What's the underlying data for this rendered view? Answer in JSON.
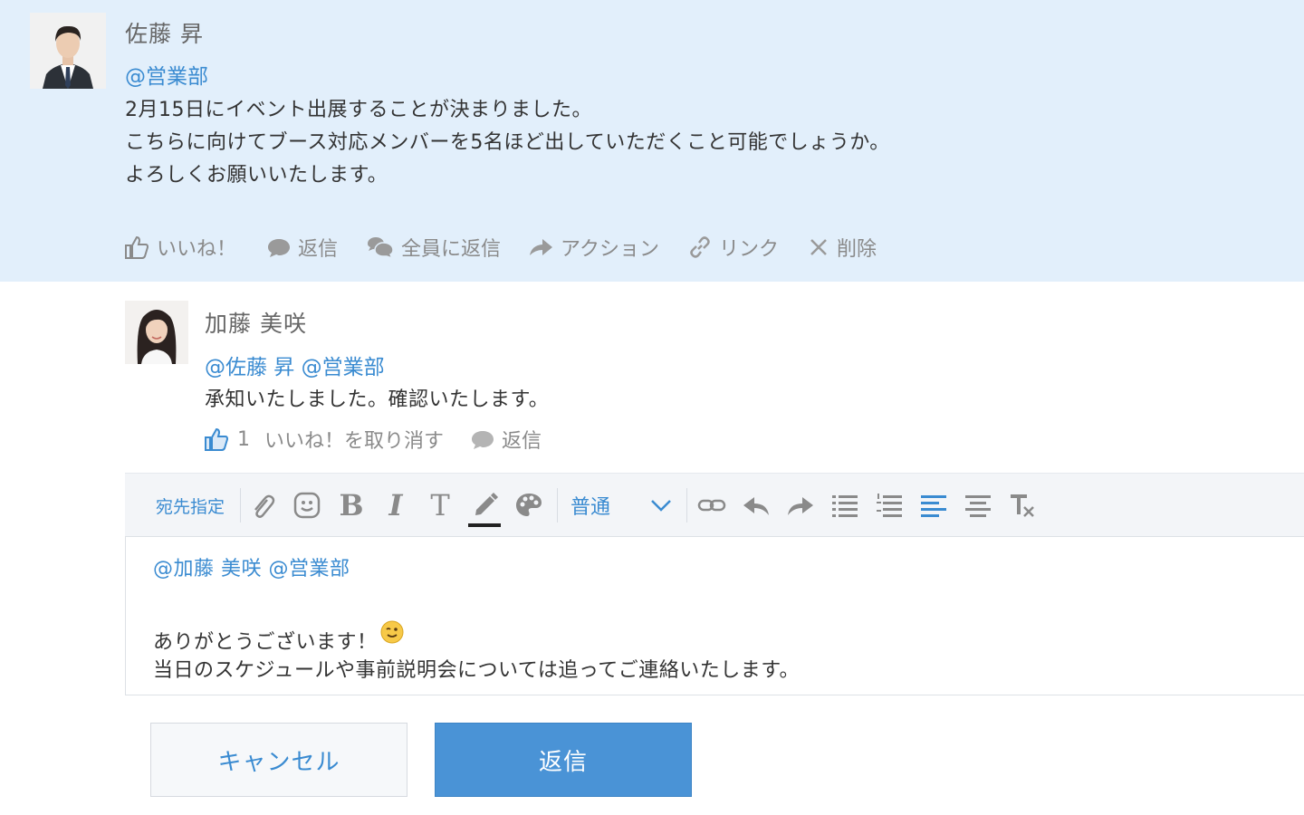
{
  "post": {
    "author": "佐藤 昇",
    "mention": "@営業部",
    "lines": [
      "2月15日にイベント出展することが決まりました。",
      "こちらに向けてブース対応メンバーを5名ほど出していただくこと可能でしょうか。",
      "よろしくお願いいたします。"
    ],
    "actions": {
      "like": "いいね！",
      "reply": "返信",
      "reply_all": "全員に返信",
      "action": "アクション",
      "link": "リンク",
      "delete": "削除"
    }
  },
  "comment": {
    "author": "加藤 美咲",
    "mention": "@佐藤 昇 @営業部",
    "text": "承知いたしました。確認いたします。",
    "like_count": "1",
    "unlike": "いいね！を取り消す",
    "reply": "返信"
  },
  "toolbar": {
    "recipient": "宛先指定",
    "format_select": "普通"
  },
  "editor": {
    "mention": "@加藤 美咲 @営業部",
    "line1": "ありがとうございます！",
    "line2": "当日のスケジュールや事前説明会については追ってご連絡いたします。"
  },
  "buttons": {
    "cancel": "キャンセル",
    "reply": "返信"
  },
  "colors": {
    "post_bg": "#e2effb",
    "accent": "#3a8bd1",
    "primary_button": "#4a93d6"
  },
  "icons": {
    "like": "thumbs-up-icon",
    "reply": "speech-bubble-icon",
    "reply_all": "double-speech-bubble-icon",
    "action": "arrow-right-icon",
    "link": "link-icon",
    "delete": "close-icon",
    "emoji": "wink-emoji-icon"
  }
}
